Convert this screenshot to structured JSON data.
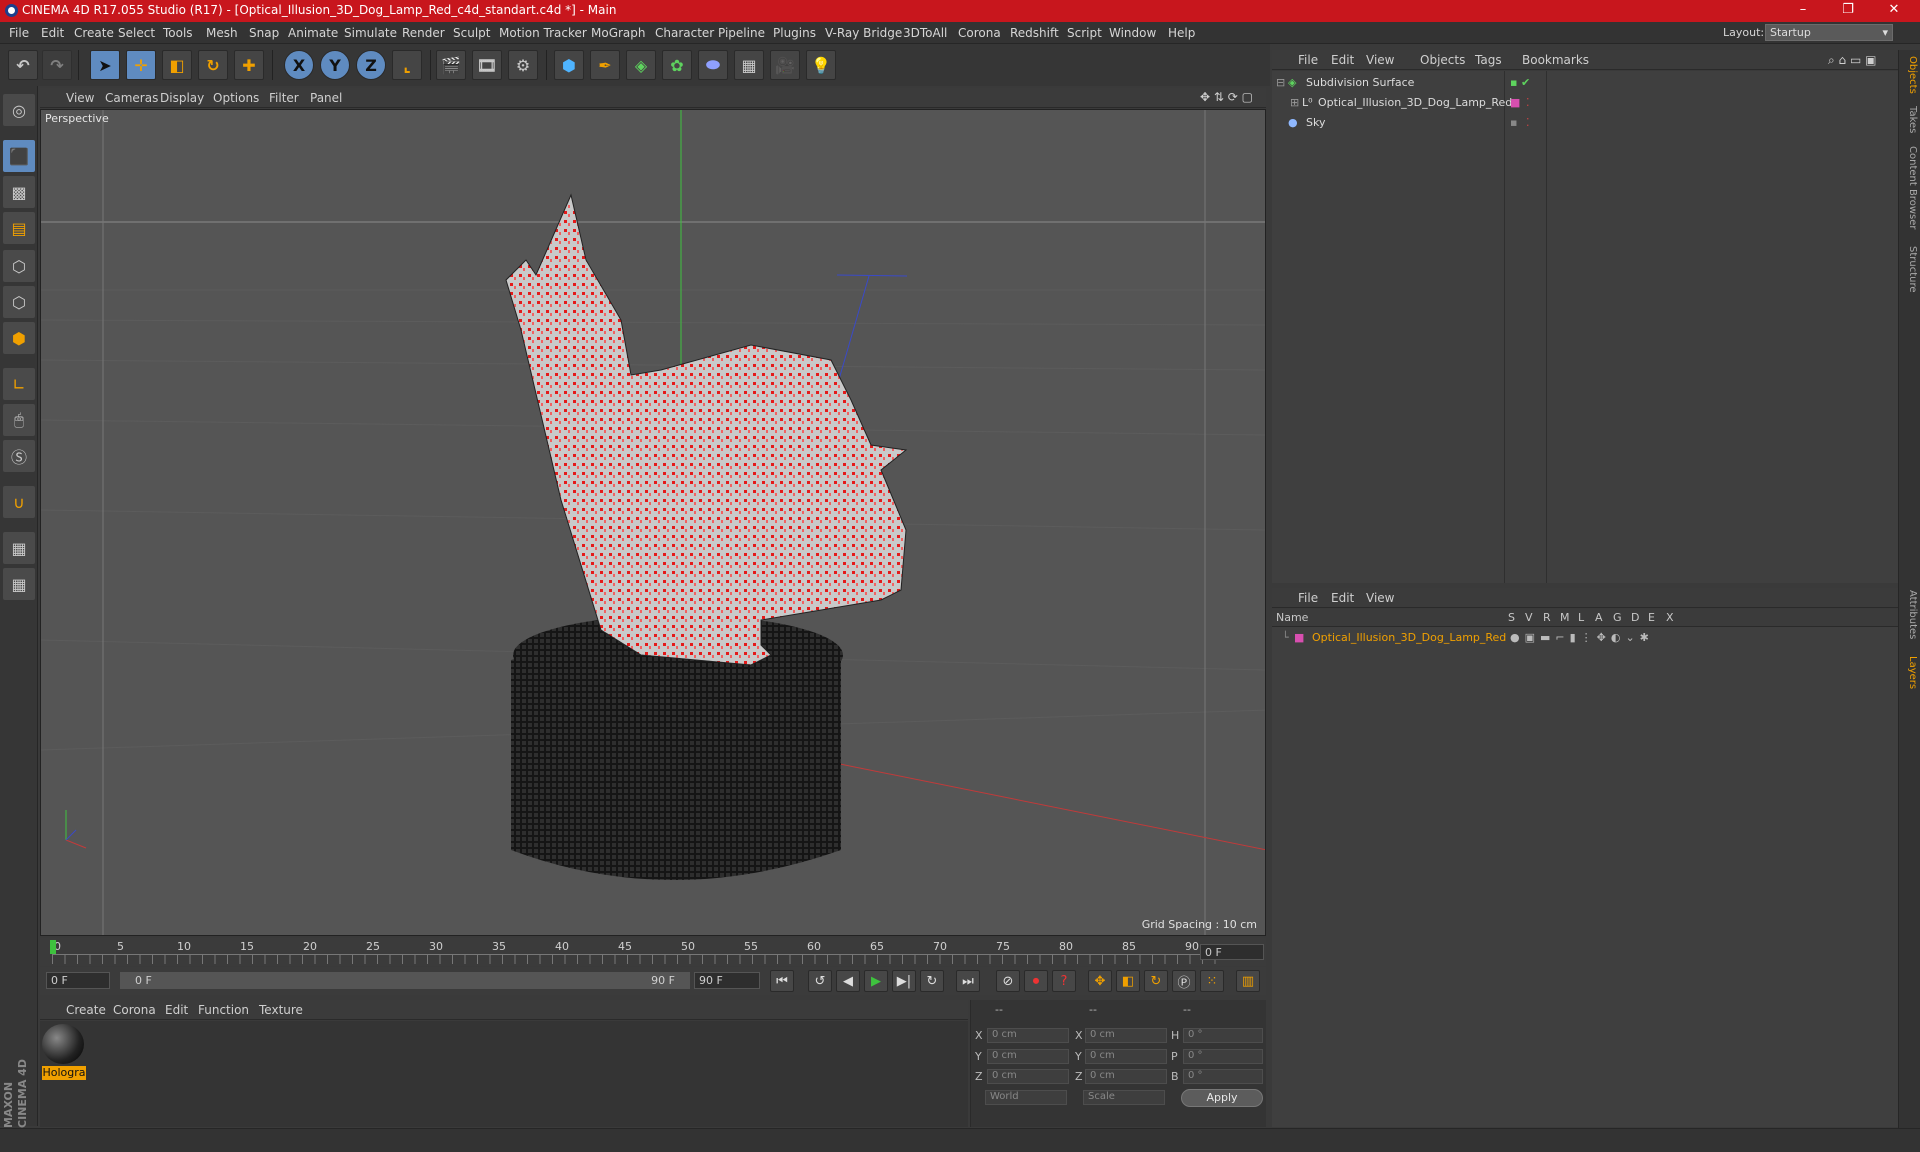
{
  "window": {
    "title": "CINEMA 4D R17.055 Studio (R17) - [Optical_Illusion_3D_Dog_Lamp_Red_c4d_standart.c4d *] - Main",
    "controls": [
      "–",
      "❐",
      "✕"
    ]
  },
  "menubar": {
    "items": [
      "File",
      "Edit",
      "Create",
      "Select",
      "Tools",
      "Mesh",
      "Snap",
      "Animate",
      "Simulate",
      "Render",
      "Sculpt",
      "Motion Tracker",
      "MoGraph",
      "Character",
      "Pipeline",
      "Plugins",
      "V-Ray Bridge",
      "3DToAll",
      "Corona",
      "Redshift",
      "Script",
      "Window",
      "Help"
    ],
    "layout_label": "Layout:",
    "layout_value": "Startup"
  },
  "toolbar": {
    "axis_x": "X",
    "axis_y": "Y",
    "axis_z": "Z"
  },
  "viewport": {
    "menu": [
      "View",
      "Cameras",
      "Display",
      "Options",
      "Filter",
      "Panel"
    ],
    "camera_label": "Perspective",
    "grid_spacing": "Grid Spacing : 10 cm"
  },
  "timeline": {
    "ticks": [
      "0",
      "5",
      "10",
      "15",
      "20",
      "25",
      "30",
      "35",
      "40",
      "45",
      "50",
      "55",
      "60",
      "65",
      "70",
      "75",
      "80",
      "85",
      "90"
    ],
    "current_frame": "0 F"
  },
  "transport": {
    "start": "0 F",
    "range_start": "0 F",
    "range_end": "90 F",
    "end": "90 F"
  },
  "material_manager": {
    "menu": [
      "Create",
      "Corona",
      "Edit",
      "Function",
      "Texture"
    ],
    "material_name": "Hologra"
  },
  "coordinates": {
    "headers": [
      "--",
      "--",
      "--"
    ],
    "rows": [
      {
        "a": "X",
        "av": "0 cm",
        "b": "X",
        "bv": "0 cm",
        "c": "H",
        "cv": "0 °"
      },
      {
        "a": "Y",
        "av": "0 cm",
        "b": "Y",
        "bv": "0 cm",
        "c": "P",
        "cv": "0 °"
      },
      {
        "a": "Z",
        "av": "0 cm",
        "b": "Z",
        "bv": "0 cm",
        "c": "B",
        "cv": "0 °"
      }
    ],
    "mode_world": "World",
    "mode_scale": "Scale",
    "apply": "Apply"
  },
  "object_manager": {
    "menu": [
      "File",
      "Edit",
      "View",
      "Objects",
      "Tags",
      "Bookmarks"
    ],
    "objects": [
      {
        "name": "Subdivision Surface",
        "indent": 0
      },
      {
        "name": "Optical_Illusion_3D_Dog_Lamp_Red",
        "indent": 1
      },
      {
        "name": "Sky",
        "indent": 0
      }
    ]
  },
  "layer_manager": {
    "menu": [
      "File",
      "Edit",
      "View"
    ],
    "columns": [
      "Name",
      "S",
      "V",
      "R",
      "M",
      "L",
      "A",
      "G",
      "D",
      "E",
      "X"
    ],
    "layer_name": "Optical_Illusion_3D_Dog_Lamp_Red",
    "layer_color": "#d84fb0"
  },
  "side_tabs": [
    "Objects",
    "Takes",
    "Content Browser",
    "Structure",
    "Attributes",
    "Layers"
  ],
  "branding": "MAXON CINEMA 4D",
  "colors": {
    "accent": "#c8161d",
    "active_tool": "#5f8bc0",
    "highlight": "#f0a000"
  }
}
